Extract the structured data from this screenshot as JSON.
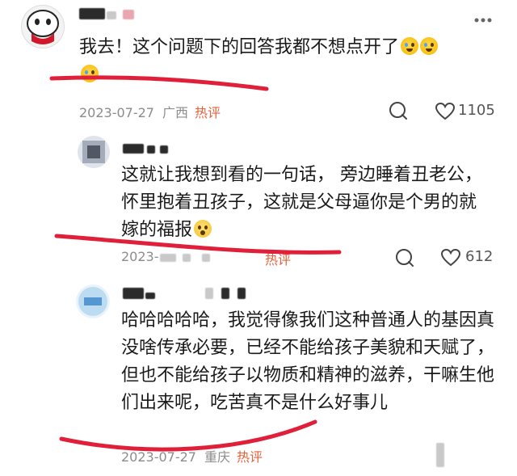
{
  "comments": [
    {
      "text": "我去！这个问题下的回答我都不想点开了",
      "emojis": [
        "cry-laugh-emoji",
        "cry-laugh-emoji",
        "cry-laugh-emoji"
      ],
      "date": "2023-07-27",
      "location": "广西",
      "hot_label": "热评",
      "like_count": "1105"
    },
    {
      "text": "这就让我想到看的一句话， 旁边睡着丑老公，怀里抱着丑孩子，这就是父母逼你是个男的就嫁的福报",
      "emojis": [
        "flushed-emoji"
      ],
      "date": "2023-",
      "hot_label": "热评",
      "like_count": "612"
    },
    {
      "text": "哈哈哈哈哈，我觉得像我们这种普通人的基因真没啥传承必要，已经不能给孩子美貌和天赋了，但也不能给孩子以物质和精神的滋养，干嘛生他们出来呢，吃苦真不是什么好事儿",
      "date": "2023-07-27",
      "location": "重庆",
      "hot_label": "热评"
    }
  ],
  "colors": {
    "hot": "#e8613c",
    "meta": "#8c8c8c",
    "annotation_line": "#e0203a"
  },
  "icons": [
    "reply-bubble-icon",
    "heart-icon",
    "more-icon"
  ]
}
